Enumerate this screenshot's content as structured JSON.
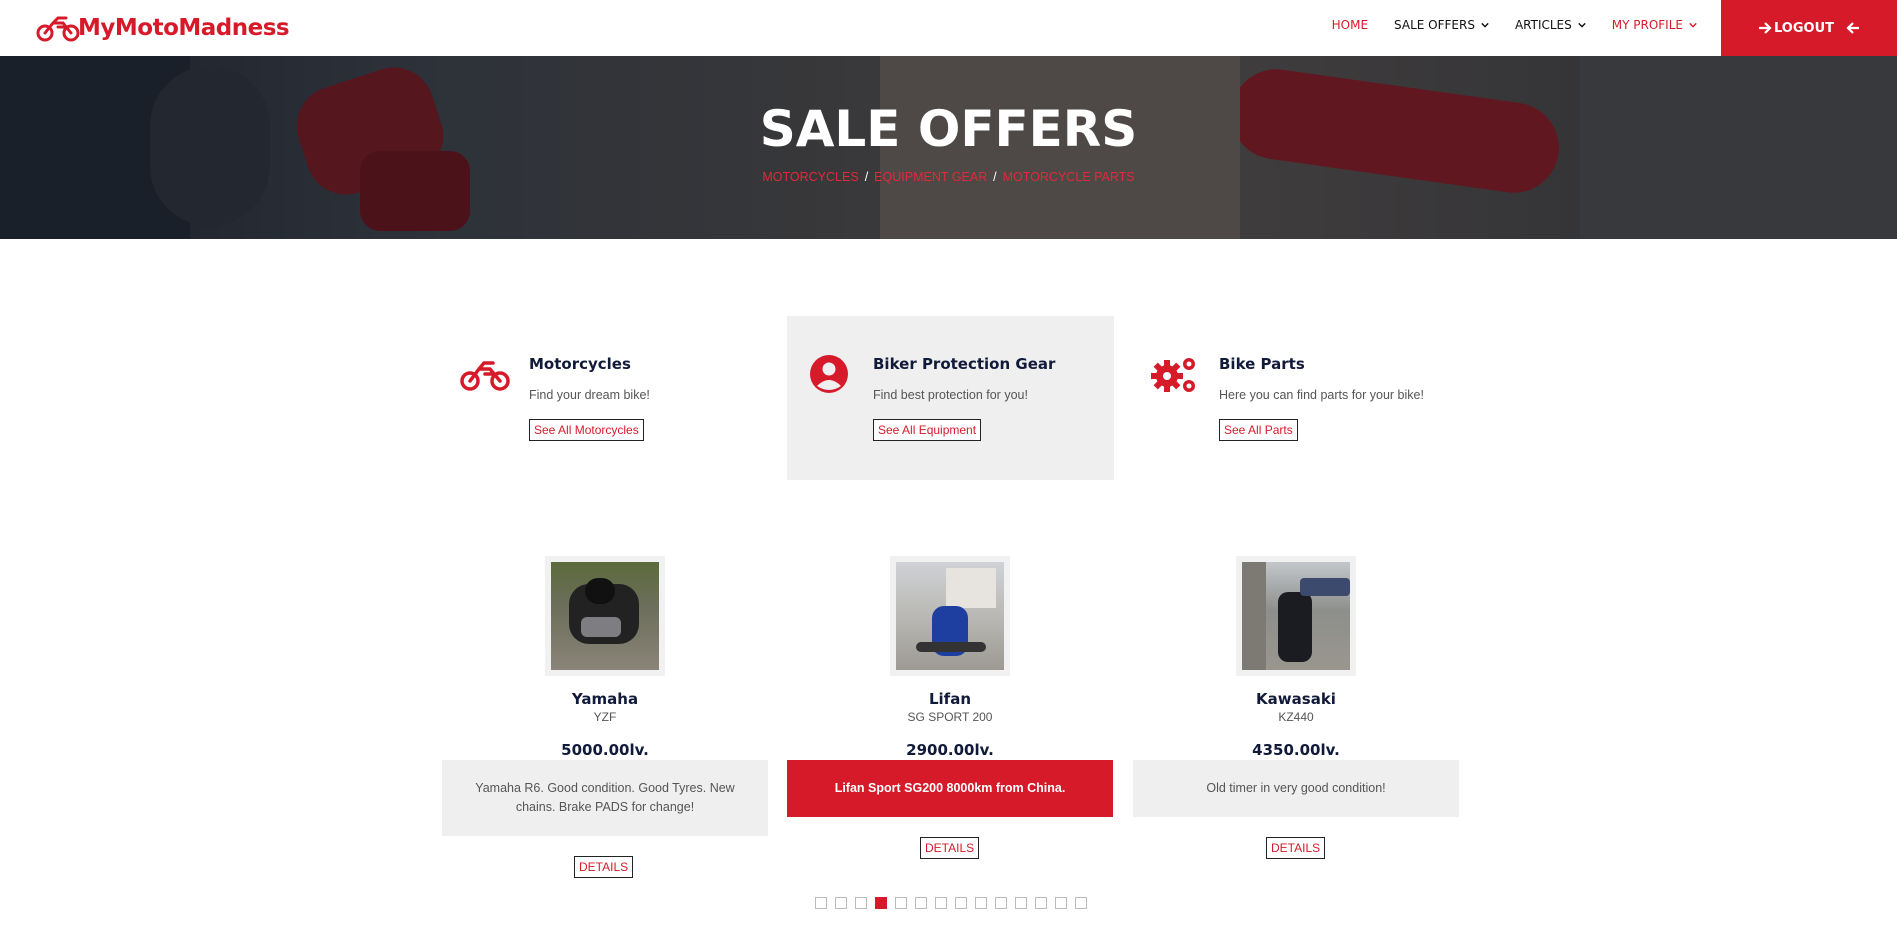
{
  "brand": {
    "name": "MyMotoMadness",
    "icon": "motorcycle-icon",
    "color": "#d71a2a"
  },
  "nav": {
    "items": [
      {
        "label": "HOME",
        "active": true,
        "dropdown": false
      },
      {
        "label": "SALE OFFERS",
        "active": false,
        "dropdown": true
      },
      {
        "label": "ARTICLES",
        "active": false,
        "dropdown": true
      },
      {
        "label": "MY PROFILE",
        "active": true,
        "dropdown": true
      }
    ],
    "logout_label": "LOGOUT"
  },
  "hero": {
    "title": "SALE OFFERS",
    "breadcrumb": [
      "MOTORCYCLES",
      "EQUIPMENT GEAR",
      "MOTORCYCLE PARTS"
    ],
    "separator": "/"
  },
  "categories": [
    {
      "title": "Motorcycles",
      "description": "Find your dream bike!",
      "button": "See All Motorcycles",
      "icon": "motorcycle-icon"
    },
    {
      "title": "Biker Protection Gear",
      "description": "Find best protection for you!",
      "button": "See All Equipment",
      "icon": "user-circle-icon"
    },
    {
      "title": "Bike Parts",
      "description": "Here you can find parts for your bike!",
      "button": "See All Parts",
      "icon": "gears-icon"
    }
  ],
  "offers": [
    {
      "brand": "Yamaha",
      "model": "YZF",
      "price": "5000.00lv.",
      "description": "Yamaha R6. Good condition. Good Tyres. New chains. Brake PADS for change!",
      "details": "DETAILS"
    },
    {
      "brand": "Lifan",
      "model": "SG SPORT 200",
      "price": "2900.00lv.",
      "description": "Lifan Sport SG200 8000km from China.",
      "details": "DETAILS"
    },
    {
      "brand": "Kawasaki",
      "model": "KZ440",
      "price": "4350.00lv.",
      "description": "Old timer in very good condition!",
      "details": "DETAILS"
    }
  ],
  "pagination": {
    "total": 14,
    "active_index": 3
  },
  "colors": {
    "accent": "#d71a2a",
    "heading": "#121a3a",
    "panel": "#efefef"
  }
}
